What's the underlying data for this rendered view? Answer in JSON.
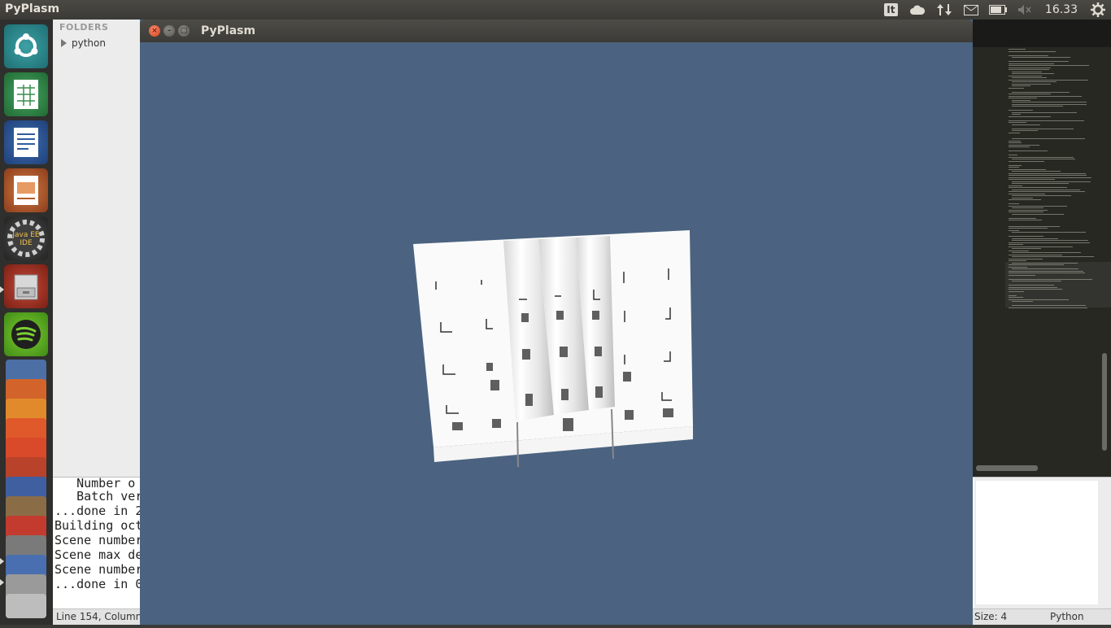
{
  "top_panel": {
    "app_title": "PyPlasm",
    "keyboard_layout": "It",
    "clock": "16.33",
    "icons": [
      "cloud-icon",
      "network-updown-icon",
      "mail-icon",
      "battery-icon",
      "volume-muted-icon",
      "gear-icon"
    ]
  },
  "launcher": {
    "items": [
      "Ubuntu Dash",
      "LibreOffice Calc",
      "LibreOffice Writer",
      "LibreOffice Impress",
      "Java EE IDE",
      "Files",
      "Spotify"
    ],
    "java_label": "Java EE IDE"
  },
  "sidebar": {
    "header": "FOLDERS",
    "folder": "python"
  },
  "pyplasm_window": {
    "title": "PyPlasm",
    "background_color": "#4b6380"
  },
  "console": {
    "lines": [
      "   Number o",
      "   Batch ver",
      "...done in 2",
      "Building oct",
      "Scene number",
      "Scene max de",
      "Scene number",
      "...done in 0"
    ]
  },
  "statusbar": {
    "position": "Line 154, Column",
    "tab_size": "Size: 4",
    "syntax": "Python"
  },
  "colors": {
    "panel": "#3b3a36",
    "launcher": "#2f2f2d",
    "editor_bg": "#272822",
    "viewport_bg": "#4b6380"
  }
}
